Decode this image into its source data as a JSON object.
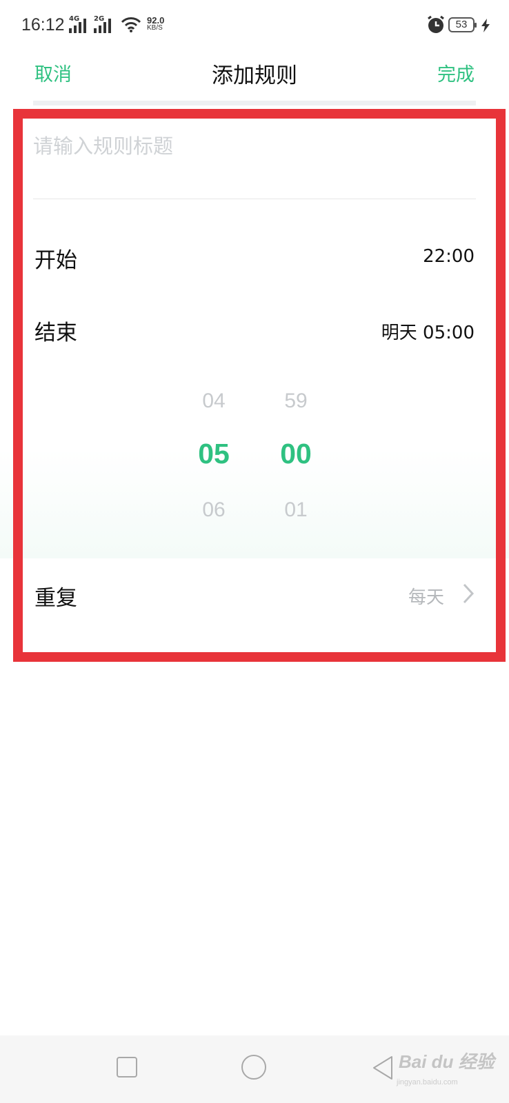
{
  "status_bar": {
    "time": "16:12",
    "signal1_tag": "4G",
    "signal2_tag": "2G",
    "net_speed": "92.0",
    "net_unit": "KB/S",
    "battery": "53"
  },
  "header": {
    "cancel": "取消",
    "title": "添加规则",
    "done": "完成",
    "accent_color": "#2fc181"
  },
  "form": {
    "title_placeholder": "请输入规则标题",
    "title_value": "",
    "start_label": "开始",
    "start_value": "22:00",
    "end_label": "结束",
    "end_value": "明天 05:00",
    "repeat_label": "重复",
    "repeat_value": "每天"
  },
  "time_picker": {
    "hours": {
      "prev": "04",
      "selected": "05",
      "next": "06"
    },
    "minutes": {
      "prev": "59",
      "selected": "00",
      "next": "01"
    }
  },
  "watermark": {
    "logo": "Bai du 经验",
    "url": "jingyan.baidu.com"
  },
  "highlight_color": "#e8343a"
}
